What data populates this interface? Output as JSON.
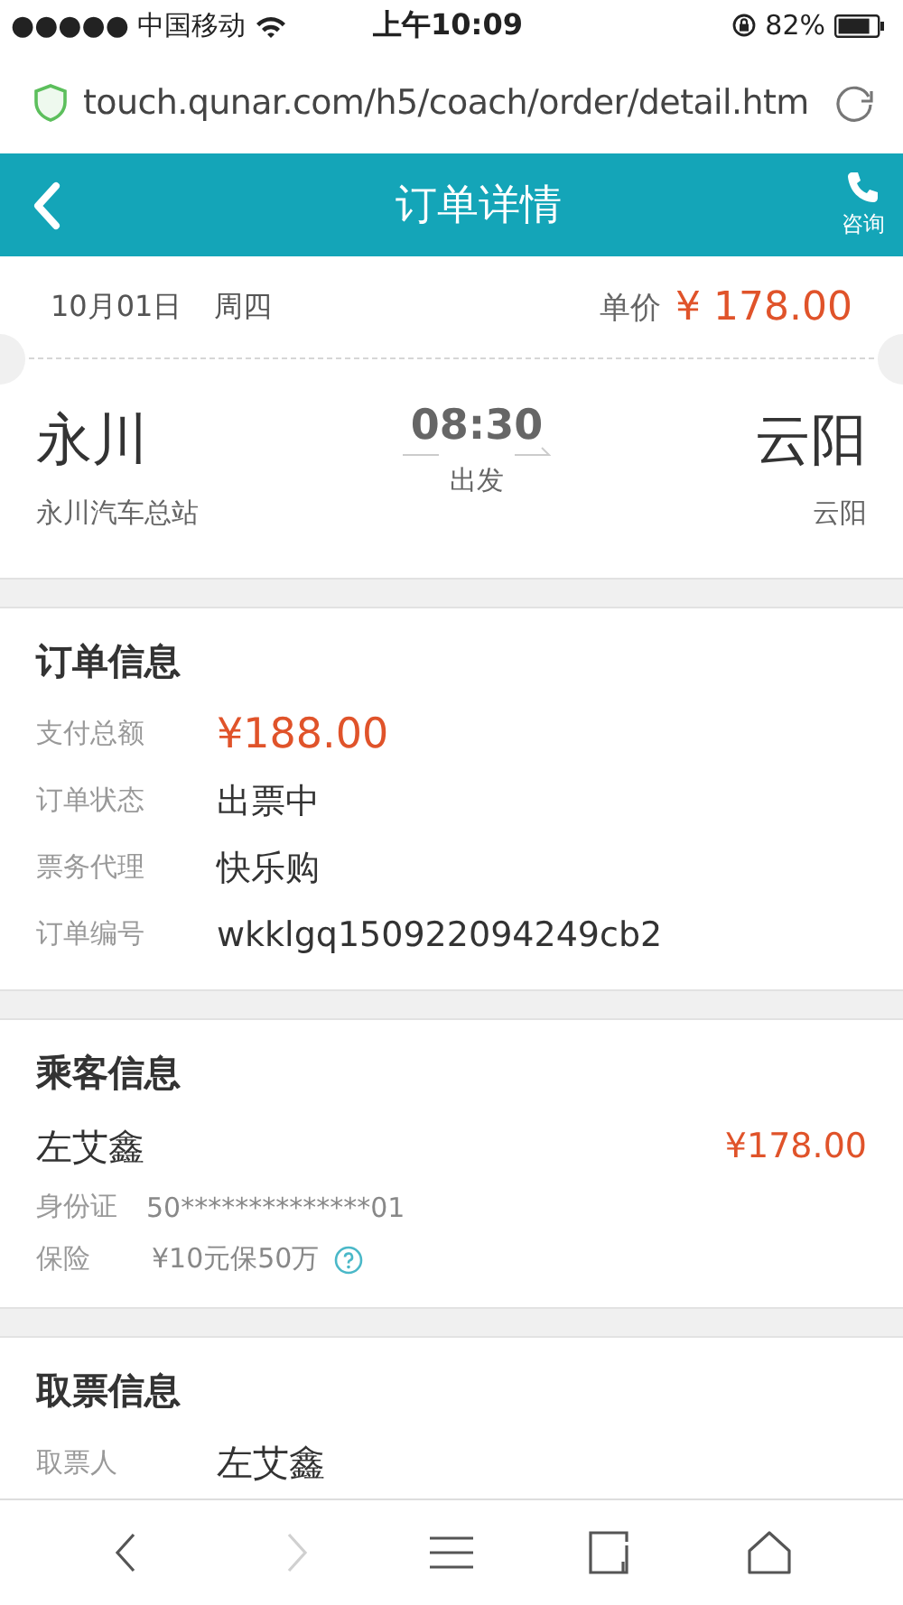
{
  "status_bar": {
    "carrier": "●●●●● 中国移动",
    "time": "上午10:09",
    "battery": "82%"
  },
  "address_bar": {
    "url": "touch.qunar.com/h5/coach/order/detail.htm"
  },
  "header": {
    "title": "订单详情",
    "action": "咨询"
  },
  "ticket": {
    "date": "10月01日",
    "weekday": "周四",
    "price_label": "单价",
    "price": "¥ 178.00",
    "from": "永川",
    "from_station": "永川汽车总站",
    "time": "08:30",
    "depart": "出发",
    "to": "云阳",
    "to_station": "云阳"
  },
  "sections": [
    {
      "title": "订单信息",
      "rows": [
        {
          "label": "支付总额",
          "value": "¥188.00",
          "kind": "price"
        },
        {
          "label": "订单状态",
          "value": "出票中",
          "kind": "text"
        },
        {
          "label": "票务代理",
          "value": "快乐购",
          "kind": "text"
        },
        {
          "label": "订单编号",
          "value": "wkklgq150922094249cb2",
          "kind": "text"
        }
      ]
    },
    {
      "title": "乘客信息",
      "passenger": {
        "name": "左艾鑫",
        "price": "¥178.00"
      },
      "rows": [
        {
          "label": "身份证",
          "value": "50**************01",
          "kind": "small"
        },
        {
          "label": "保险",
          "value": "¥10元保50万",
          "kind": "help"
        }
      ]
    },
    {
      "title": "取票信息",
      "rows": [
        {
          "label": "取票人",
          "value": "左艾鑫",
          "kind": "wide"
        }
      ]
    }
  ],
  "toolbar": [
    {
      "kind": "back",
      "disabled": false
    },
    {
      "kind": "forward",
      "disabled": true
    },
    {
      "kind": "menu",
      "disabled": false
    },
    {
      "kind": "tabs",
      "disabled": false
    },
    {
      "kind": "home",
      "disabled": false
    }
  ]
}
